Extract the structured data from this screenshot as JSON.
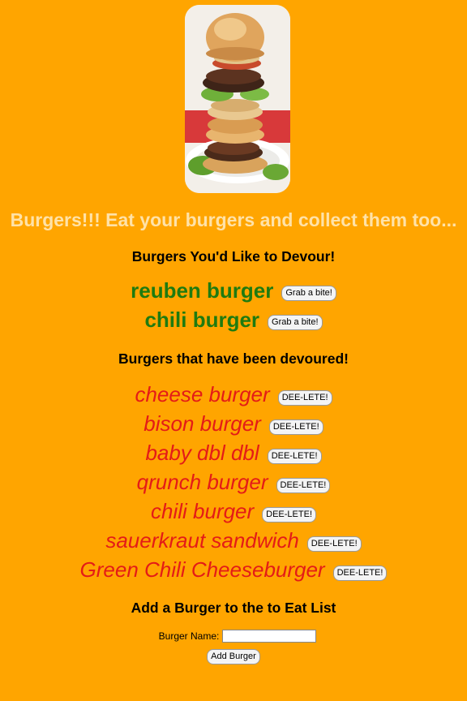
{
  "header": {
    "title": "Burgers!!! Eat your burgers and collect them too..."
  },
  "to_eat": {
    "heading": "Burgers You'd Like to Devour!",
    "button_label": "Grab a bite!",
    "items": [
      {
        "name": "reuben burger"
      },
      {
        "name": "chili burger"
      }
    ]
  },
  "devoured": {
    "heading": "Burgers that have been devoured!",
    "button_label": "DEE-LETE!",
    "items": [
      {
        "name": "cheese burger"
      },
      {
        "name": "bison burger"
      },
      {
        "name": "baby dbl dbl"
      },
      {
        "name": "qrunch burger"
      },
      {
        "name": "chili burger"
      },
      {
        "name": "sauerkraut sandwich"
      },
      {
        "name": "Green Chili Cheeseburger"
      }
    ]
  },
  "add_form": {
    "heading": "Add a Burger to the to Eat List",
    "label": "Burger Name:",
    "input_value": "",
    "submit_label": "Add Burger"
  },
  "colors": {
    "background": "#ffa500",
    "title": "#ffe2a8",
    "to_eat_name": "#1e7b10",
    "devoured_name": "#e41b17"
  }
}
